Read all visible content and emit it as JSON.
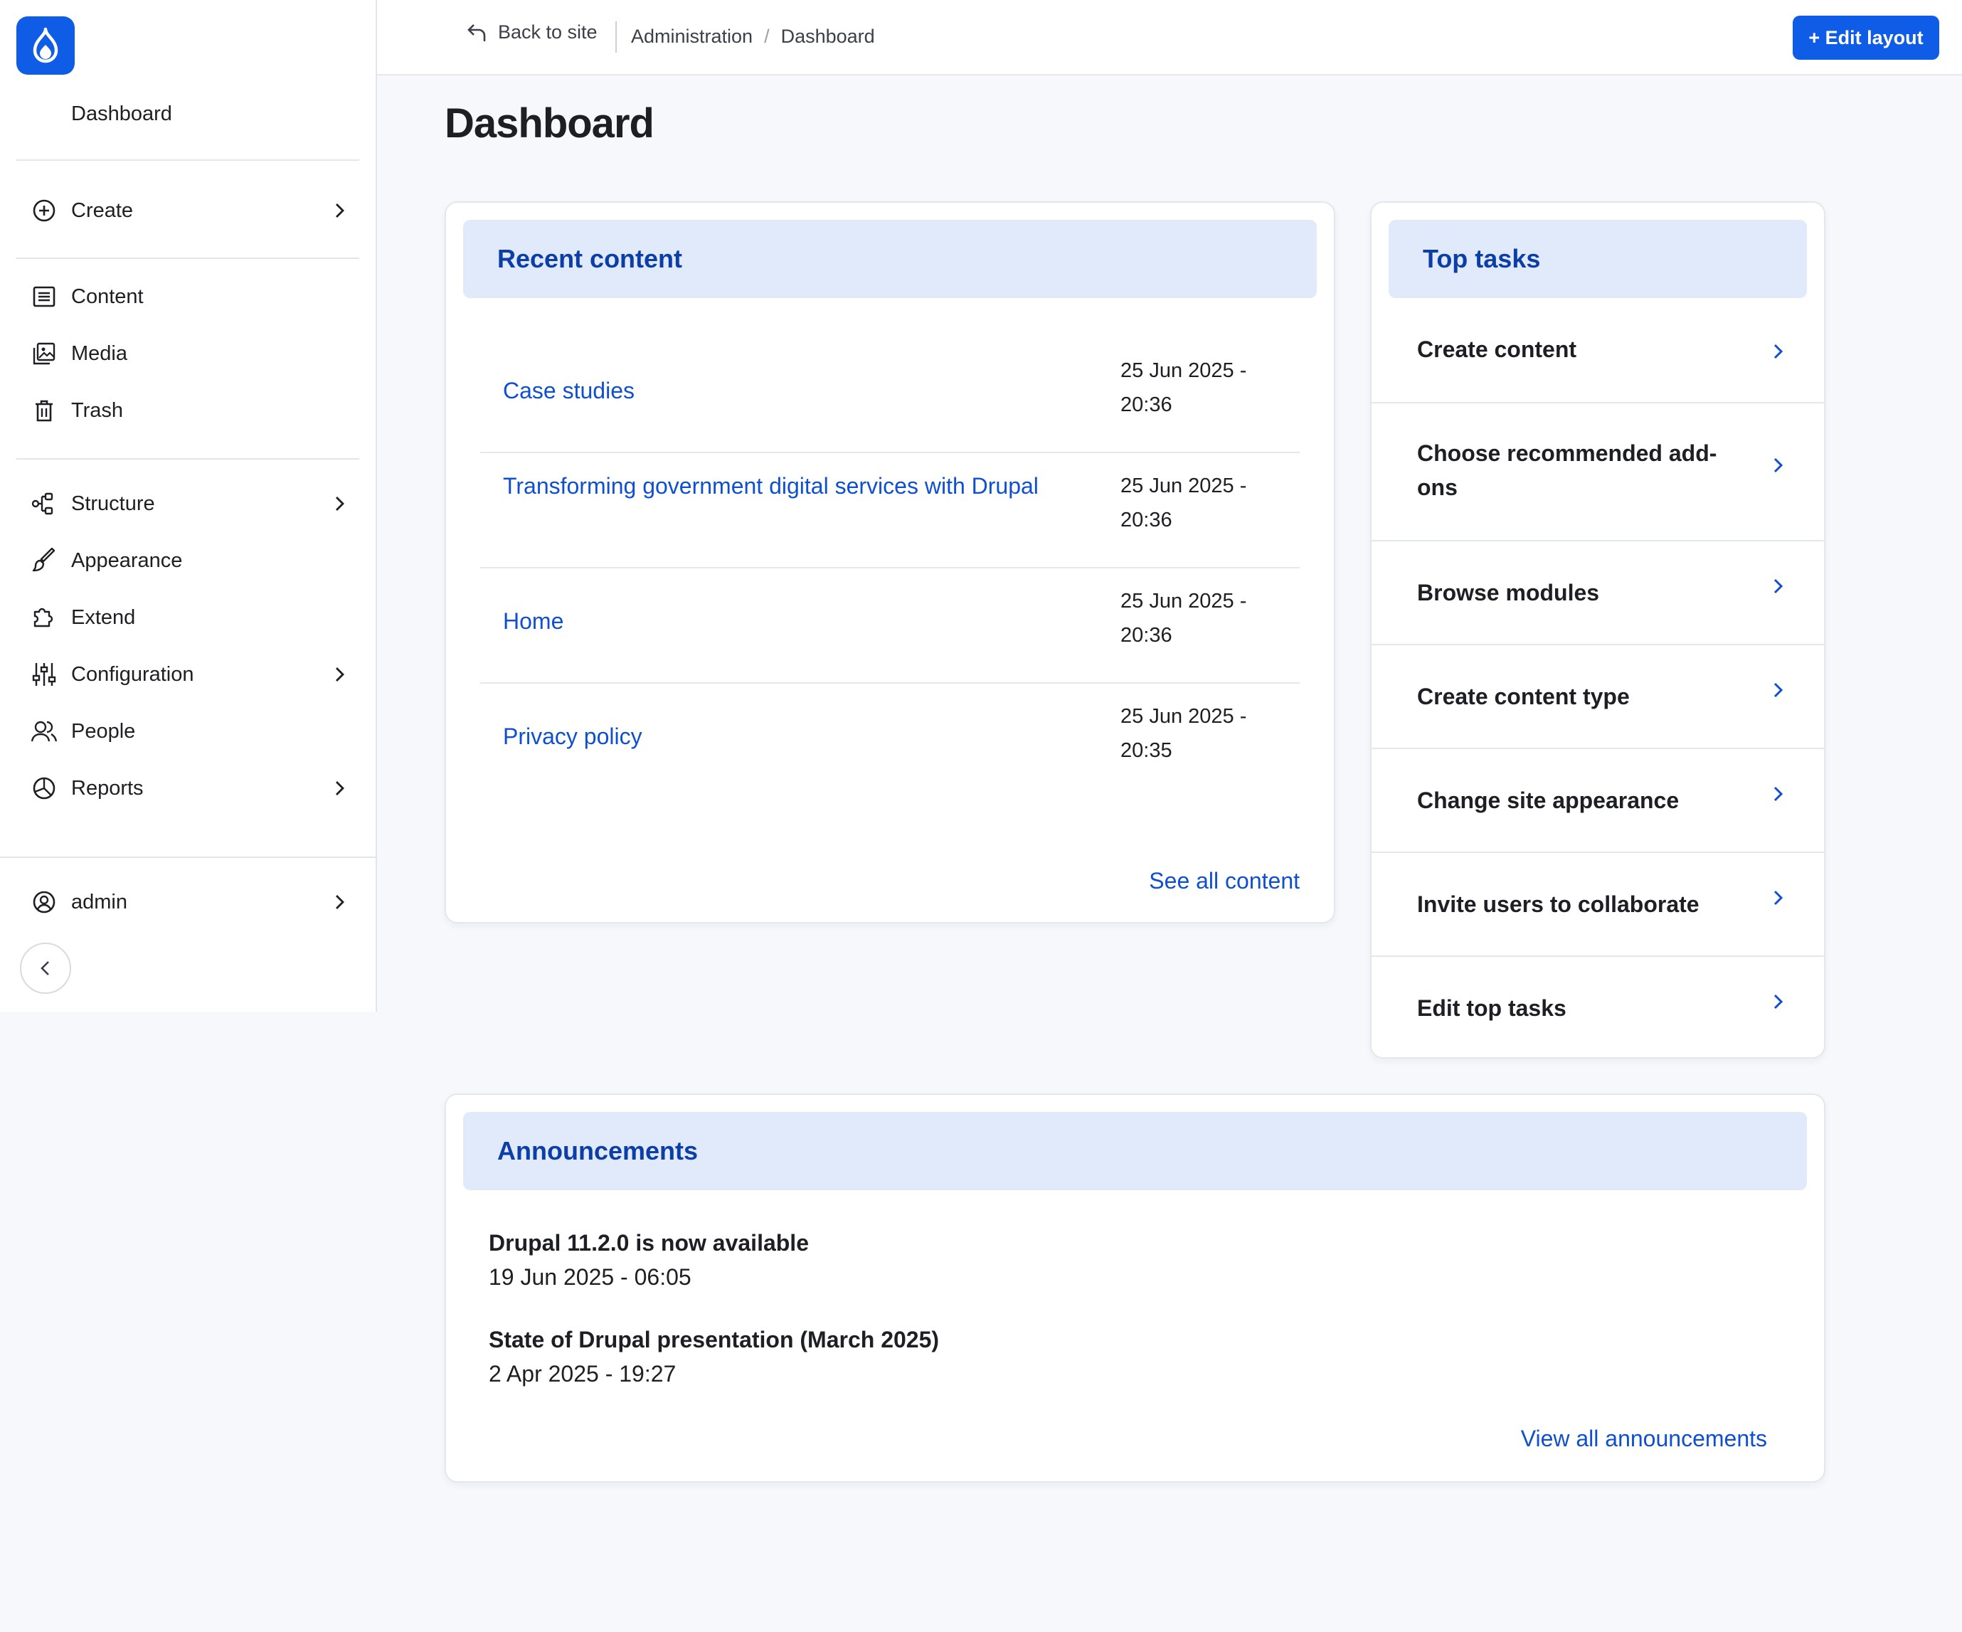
{
  "sidebar": {
    "title": "Dashboard",
    "items": [
      {
        "label": "Create"
      },
      {
        "label": "Content"
      },
      {
        "label": "Media"
      },
      {
        "label": "Trash"
      },
      {
        "label": "Structure"
      },
      {
        "label": "Appearance"
      },
      {
        "label": "Extend"
      },
      {
        "label": "Configuration"
      },
      {
        "label": "People"
      },
      {
        "label": "Reports"
      },
      {
        "label": "admin"
      }
    ]
  },
  "topbar": {
    "back_label": "Back to site",
    "breadcrumb": [
      "Administration",
      "Dashboard"
    ],
    "edit_label": "+ Edit layout"
  },
  "page": {
    "title": "Dashboard"
  },
  "recent": {
    "heading": "Recent content",
    "rows": [
      {
        "title": "Case studies",
        "date": "25 Jun 2025 - 20:36"
      },
      {
        "title": "Transforming government digital services with Drupal",
        "date": "25 Jun 2025 - 20:36"
      },
      {
        "title": "Home",
        "date": "25 Jun 2025 - 20:36"
      },
      {
        "title": "Privacy policy",
        "date": "25 Jun 2025 - 20:35"
      }
    ],
    "see_all": "See all content"
  },
  "tasks": {
    "heading": "Top tasks",
    "items": [
      {
        "label": "Create content"
      },
      {
        "label": "Choose recommended add-ons"
      },
      {
        "label": "Browse modules"
      },
      {
        "label": "Create content type"
      },
      {
        "label": "Change site appearance"
      },
      {
        "label": "Invite users to collaborate"
      },
      {
        "label": "Edit top tasks"
      }
    ]
  },
  "announcements": {
    "heading": "Announcements",
    "items": [
      {
        "title": "Drupal 11.2.0 is now available",
        "date": "19 Jun 2025 - 06:05"
      },
      {
        "title": "State of Drupal presentation (March 2025)",
        "date": "2 Apr 2025 - 19:27"
      }
    ],
    "view_all": "View all announcements"
  },
  "colors": {
    "brand": "#0f5ce6",
    "link": "#0f4fd1",
    "card_header_bg": "#e1eafb",
    "card_header_text": "#0c3ea8",
    "page_bg": "#f6f8fc"
  }
}
